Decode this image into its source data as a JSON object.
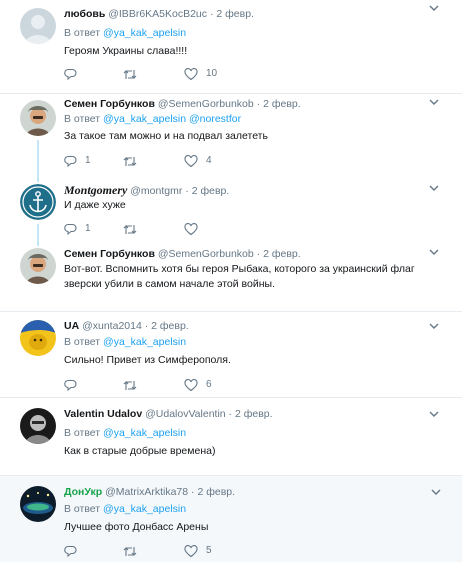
{
  "reply_prefix": "В ответ",
  "tweets": [
    {
      "name": "любовь",
      "handle": "@IBBr6KA5KocB2uc",
      "sep": "·",
      "date": "2 февр.",
      "reply_link": "@ya_kak_apelsin",
      "reply_link2": "",
      "text": "Героям Украины слава!!!!",
      "likes": "10",
      "replies": "",
      "avatar": "default-egg"
    },
    {
      "name": "Семен Горбунков",
      "handle": "@SemenGorbunkob",
      "sep": "·",
      "date": "2 февр.",
      "reply_link": "@ya_kak_apelsin",
      "reply_link2": "@norestfor",
      "text": "За такое там можно и на подвал залететь",
      "replies": "1",
      "likes": "4",
      "avatar": "man-cap"
    },
    {
      "name": "Montgomery",
      "handle": "@montgmr",
      "sep": "·",
      "date": "2 февр.",
      "text": "И даже хуже",
      "replies": "1",
      "likes": "",
      "avatar": "anchor"
    },
    {
      "name": "Семен Горбунков",
      "handle": "@SemenGorbunkob",
      "sep": "·",
      "date": "2 февр.",
      "text": "Вот-вот. Вспомнить хотя бы героя Рыбака, которого за украинский флаг зверски убили в самом начале этой войны.",
      "avatar": "man-cap"
    },
    {
      "name": "UA",
      "handle": "@xunta2014",
      "sep": "·",
      "date": "2 февр.",
      "reply_link": "@ya_kak_apelsin",
      "text": "Сильно! Привет из Симферополя.",
      "replies": "",
      "likes": "6",
      "avatar": "yellow-blue"
    },
    {
      "name": "Valentin Udalov",
      "handle": "@UdalovValentin",
      "sep": "·",
      "date": "2 февр.",
      "reply_link": "@ya_kak_apelsin",
      "text": "Как в старые добрые времена)",
      "avatar": "dark-portrait"
    },
    {
      "name": "ДонУкр",
      "handle": "@MatrixArktika78",
      "sep": "·",
      "date": "2 февр.",
      "reply_link": "@ya_kak_apelsin",
      "text": "Лучшее фото Донбасс Арены",
      "replies": "",
      "likes": "5",
      "avatar": "stadium"
    }
  ],
  "colors": {
    "link": "#1da1f2",
    "muted": "#657786",
    "thread_line": "#c4e7f8",
    "name_green": "#17a34a",
    "highlight_bg": "#f5f8fa"
  }
}
